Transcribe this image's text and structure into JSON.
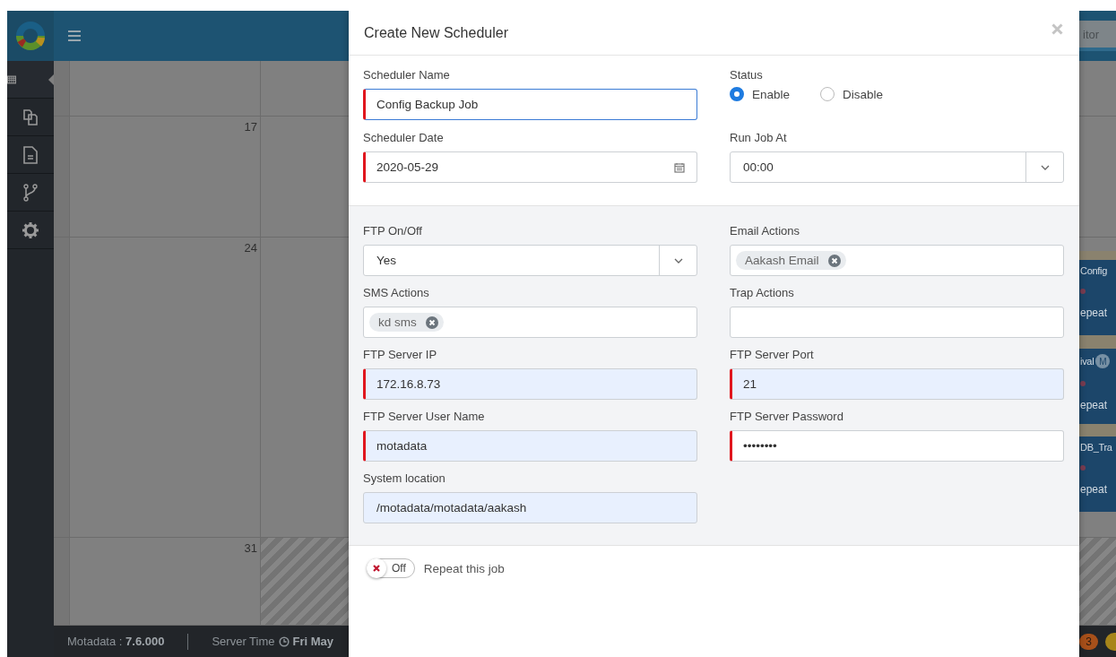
{
  "header": {
    "search_partial": "itor"
  },
  "sidebar": {
    "items": [
      {
        "kind": "grid",
        "selected": true
      },
      {
        "kind": "copy",
        "selected": false
      },
      {
        "kind": "file",
        "selected": false
      },
      {
        "kind": "branch",
        "selected": false
      },
      {
        "kind": "gear",
        "selected": false
      }
    ]
  },
  "calendar": {
    "weeks": [
      {
        "outside_month": false
      },
      {
        "day": "17",
        "outside_month": false
      },
      {
        "day": "24",
        "outside_month": false
      },
      {
        "day": "31",
        "outside_month": true
      }
    ],
    "events": [
      {
        "title": "Config",
        "repeat": "epeat"
      },
      {
        "title": "ival",
        "badge": "M",
        "repeat": "epeat"
      },
      {
        "title": "DB_Tra",
        "repeat": "epeat"
      }
    ]
  },
  "status_bar": {
    "version": "Motadata : **7.6.000**",
    "server_time_label": "Server Time",
    "server_time_value": "Fri May",
    "badge": "3"
  },
  "dialog": {
    "title": "Create New Scheduler",
    "sections": [
      {
        "fields": [
          {
            "kind": "text",
            "label": "Scheduler Name",
            "value": "Config Backup Job",
            "required": true,
            "focused": true,
            "autofilled": false
          },
          {
            "kind": "radio",
            "label": "Status",
            "options": [
              {
                "label": "Enable",
                "selected": true
              },
              {
                "label": "Disable",
                "selected": false
              }
            ]
          },
          {
            "kind": "date",
            "label": "Scheduler Date",
            "value": "2020-05-29",
            "required": true,
            "focused": false,
            "autofilled": false
          },
          {
            "kind": "select",
            "label": "Run Job At",
            "value": "00:00",
            "required": false,
            "focused": false,
            "autofilled": false
          }
        ]
      },
      {
        "fields": [
          {
            "kind": "select",
            "label": "FTP On/Off",
            "value": "Yes",
            "required": false,
            "focused": false,
            "autofilled": false
          },
          {
            "kind": "tags",
            "label": "Email Actions",
            "tags": [
              "Aakash Email"
            ],
            "required": false,
            "focused": false,
            "autofilled": false
          },
          {
            "kind": "tags",
            "label": "SMS Actions",
            "tags": [
              "kd sms"
            ],
            "required": false,
            "focused": false,
            "autofilled": false
          },
          {
            "kind": "tags",
            "label": "Trap Actions",
            "required": false,
            "focused": false,
            "autofilled": false
          },
          {
            "kind": "text",
            "label": "FTP Server IP",
            "value": "172.16.8.73",
            "required": true,
            "focused": false,
            "autofilled": true
          },
          {
            "kind": "text",
            "label": "FTP Server Port",
            "value": "21",
            "required": true,
            "focused": false,
            "autofilled": true
          },
          {
            "kind": "text",
            "label": "FTP Server User Name",
            "value": "motadata",
            "required": true,
            "focused": false,
            "autofilled": true
          },
          {
            "kind": "password",
            "label": "FTP Server Password",
            "value": "••••••••",
            "required": true,
            "focused": false,
            "autofilled": false
          },
          {
            "kind": "text",
            "label": "System location",
            "value": "/motadata/motadata/aakash",
            "required": false,
            "focused": false,
            "autofilled": true
          }
        ]
      }
    ],
    "footer": {
      "repeat": {
        "on": false,
        "state_label": "Off",
        "label": "Repeat this job"
      }
    }
  }
}
